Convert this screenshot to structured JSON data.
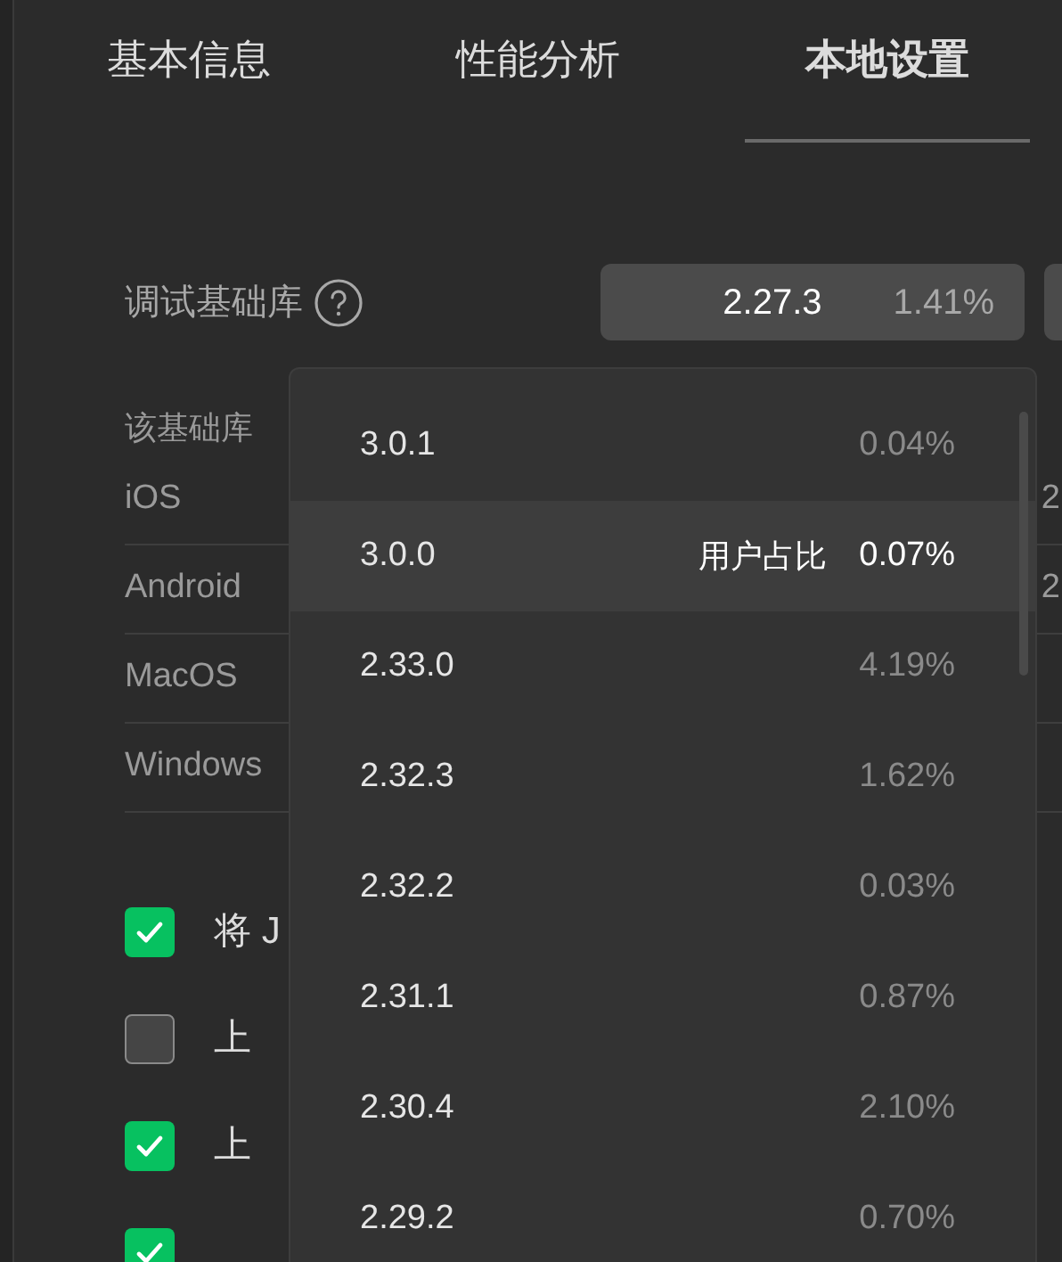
{
  "tabs": [
    {
      "label": "基本信息",
      "selected": false
    },
    {
      "label": "性能分析",
      "selected": false
    },
    {
      "label": "本地设置",
      "selected": true
    }
  ],
  "debug_library": {
    "label": "调试基础库",
    "version": "2.27.3",
    "share": "1.41%"
  },
  "platform_info": {
    "heading": "该基础库",
    "rows": [
      {
        "platform": "iOS",
        "column_2": "2"
      },
      {
        "platform": "Android",
        "column_2": "2"
      },
      {
        "platform": "MacOS"
      },
      {
        "platform": "Windows"
      }
    ]
  },
  "options": [
    {
      "label": "将 J",
      "checked": true
    },
    {
      "label": "上",
      "checked": false
    },
    {
      "label": "上",
      "checked": true
    },
    {
      "checked": true
    }
  ],
  "dropdown": {
    "items": [
      {
        "version": "3.0.1",
        "share": "0.04%",
        "selected": false
      },
      {
        "version": "3.0.0",
        "share": "0.07%",
        "selected": true,
        "hint": "用户占比"
      },
      {
        "version": "2.33.0",
        "share": "4.19%",
        "selected": false
      },
      {
        "version": "2.32.3",
        "share": "1.62%",
        "selected": false
      },
      {
        "version": "2.32.2",
        "share": "0.03%",
        "selected": false
      },
      {
        "version": "2.31.1",
        "share": "0.87%",
        "selected": false
      },
      {
        "version": "2.30.4",
        "share": "2.10%",
        "selected": false
      },
      {
        "version": "2.29.2",
        "share": "0.70%",
        "selected": false
      }
    ]
  }
}
